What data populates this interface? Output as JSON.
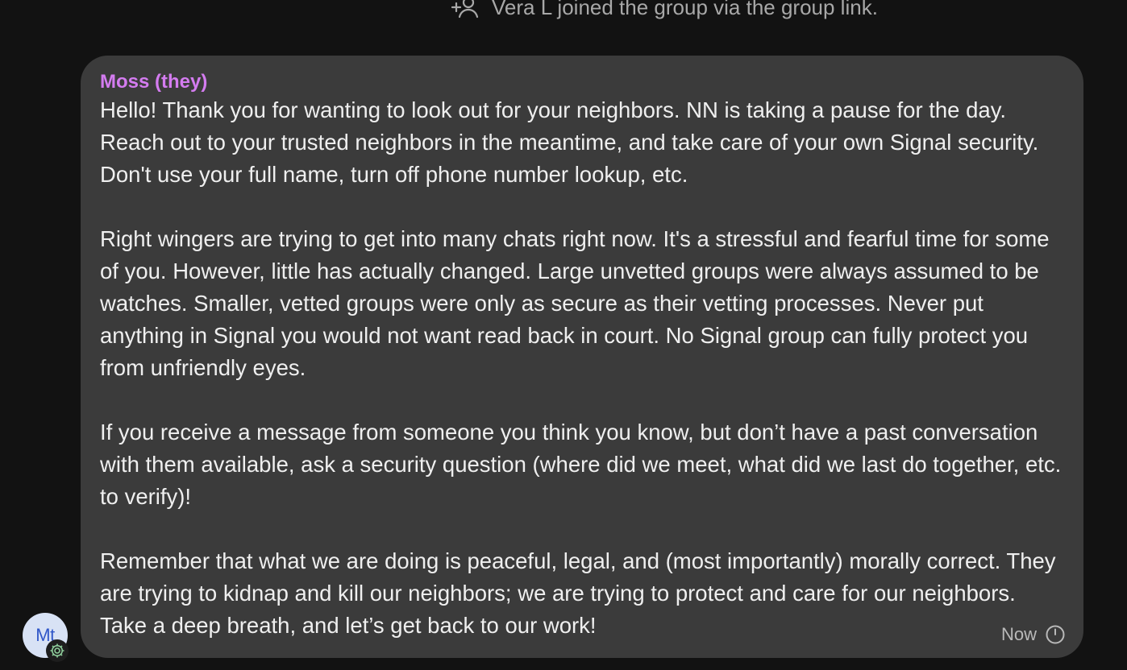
{
  "system_notice": {
    "text": "Vera L joined the group via the group link.",
    "icon": "add-person-icon"
  },
  "message": {
    "sender": "Moss (they)",
    "sender_color": "#d47cf0",
    "paragraphs": [
      "Hello! Thank you for wanting to look out for your neighbors.  NN is taking a pause for the day. Reach out to your trusted neighbors in the meantime, and take care of your own Signal security. Don't use your full name, turn off phone number lookup, etc.",
      "Right wingers are trying to get into many chats right now. It's a stressful and fearful time for some of you. However, little has actually changed. Large unvetted groups were always assumed to be watches. Smaller, vetted groups were only as secure as their vetting processes. Never put anything in Signal you would not want read back in court. No Signal group can fully protect you from unfriendly eyes.",
      "If you receive a message from someone you think you know, but don’t have a past conversation with them available, ask a security question (where did we meet, what did we last do together, etc. to verify)!",
      "Remember that what we are doing is peaceful, legal, and (most importantly) morally correct. They are trying to kidnap and kill our neighbors; we are trying to protect and care for our neighbors. Take a deep breath, and let’s get back to our work!"
    ],
    "timestamp": "Now",
    "timer_icon": "disappearing-timer-icon"
  },
  "avatar": {
    "initials": "Mt",
    "badge_icon": "admin-gear-icon"
  }
}
